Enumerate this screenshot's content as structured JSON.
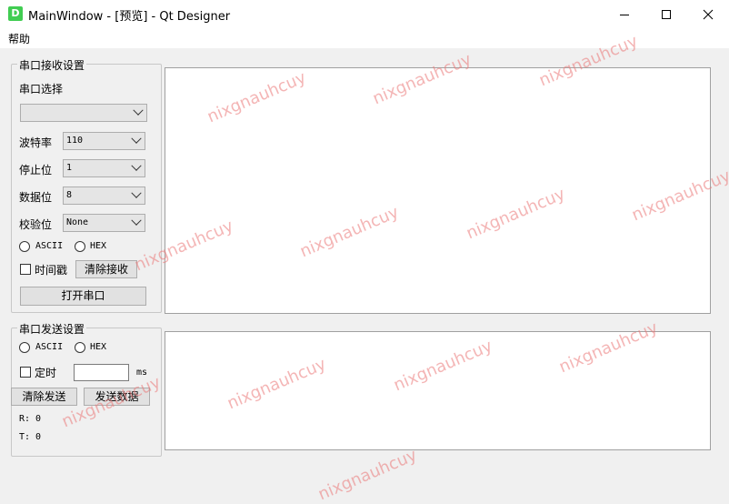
{
  "window": {
    "title": "MainWindow - [预览] - Qt Designer",
    "icon_letter": "D"
  },
  "menu": {
    "items": [
      {
        "label": "帮助"
      }
    ]
  },
  "receive_settings": {
    "group_title": "串口接收设置",
    "port_label": "串口选择",
    "port_value": "",
    "baud_label": "波特率",
    "baud_value": "110",
    "stop_label": "停止位",
    "stop_value": "1",
    "data_label": "数据位",
    "data_value": "8",
    "parity_label": "校验位",
    "parity_value": "None",
    "ascii_label": "ASCII",
    "hex_label": "HEX",
    "timestamp_label": "时间戳",
    "clear_receive_label": "清除接收",
    "open_port_label": "打开串口"
  },
  "send_settings": {
    "group_title": "串口发送设置",
    "ascii_label": "ASCII",
    "hex_label": "HEX",
    "timer_label": "定时",
    "timer_value": "",
    "ms_label": "ms",
    "clear_send_label": "清除发送",
    "send_data_label": "发送数据",
    "r_label": "R: 0",
    "t_label": "T: 0"
  },
  "watermark": {
    "text": "nixgnauhcuy"
  }
}
